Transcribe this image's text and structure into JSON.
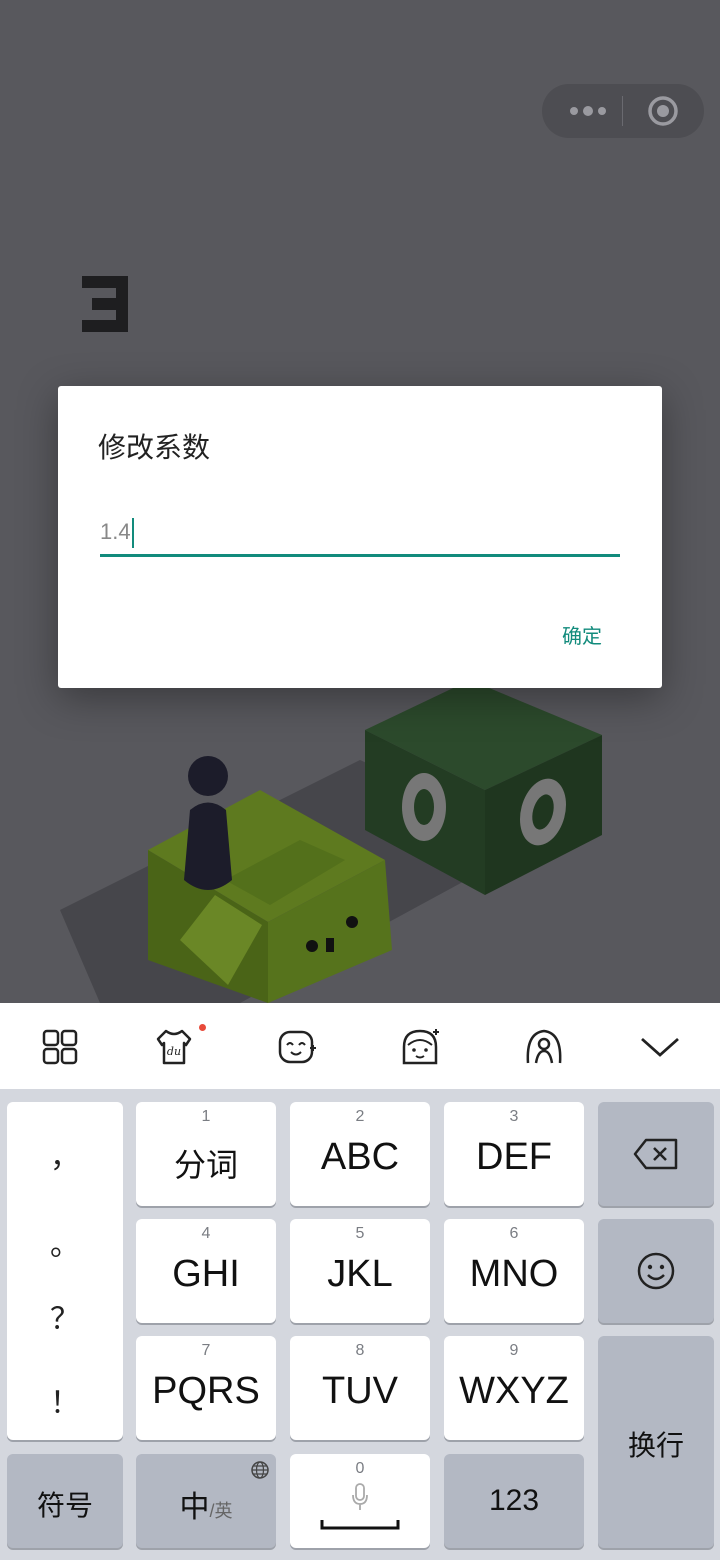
{
  "dialog": {
    "title": "修改系数",
    "input_value": "1.4",
    "confirm_label": "确定"
  },
  "colors": {
    "accent": "#128b7c",
    "game_bg": "#58585d",
    "keyboard_bg": "#d4d7de"
  },
  "keyboard": {
    "toolbar_icons": [
      "grid-icon",
      "skin-icon",
      "emoji-face-icon",
      "avatar-icon",
      "handwrite-icon",
      "chevron-down-icon"
    ],
    "punctuation": [
      "，",
      "。",
      "？",
      "！"
    ],
    "keys": [
      {
        "num": "1",
        "label": "分词"
      },
      {
        "num": "2",
        "label": "ABC"
      },
      {
        "num": "3",
        "label": "DEF"
      },
      {
        "num": "4",
        "label": "GHI"
      },
      {
        "num": "5",
        "label": "JKL"
      },
      {
        "num": "6",
        "label": "MNO"
      },
      {
        "num": "7",
        "label": "PQRS"
      },
      {
        "num": "8",
        "label": "TUV"
      },
      {
        "num": "9",
        "label": "WXYZ"
      }
    ],
    "symbol_label": "符号",
    "lang_label_main": "中",
    "lang_label_sub": "/英",
    "space_num": "0",
    "num_mode_label": "123",
    "enter_label": "换行"
  }
}
